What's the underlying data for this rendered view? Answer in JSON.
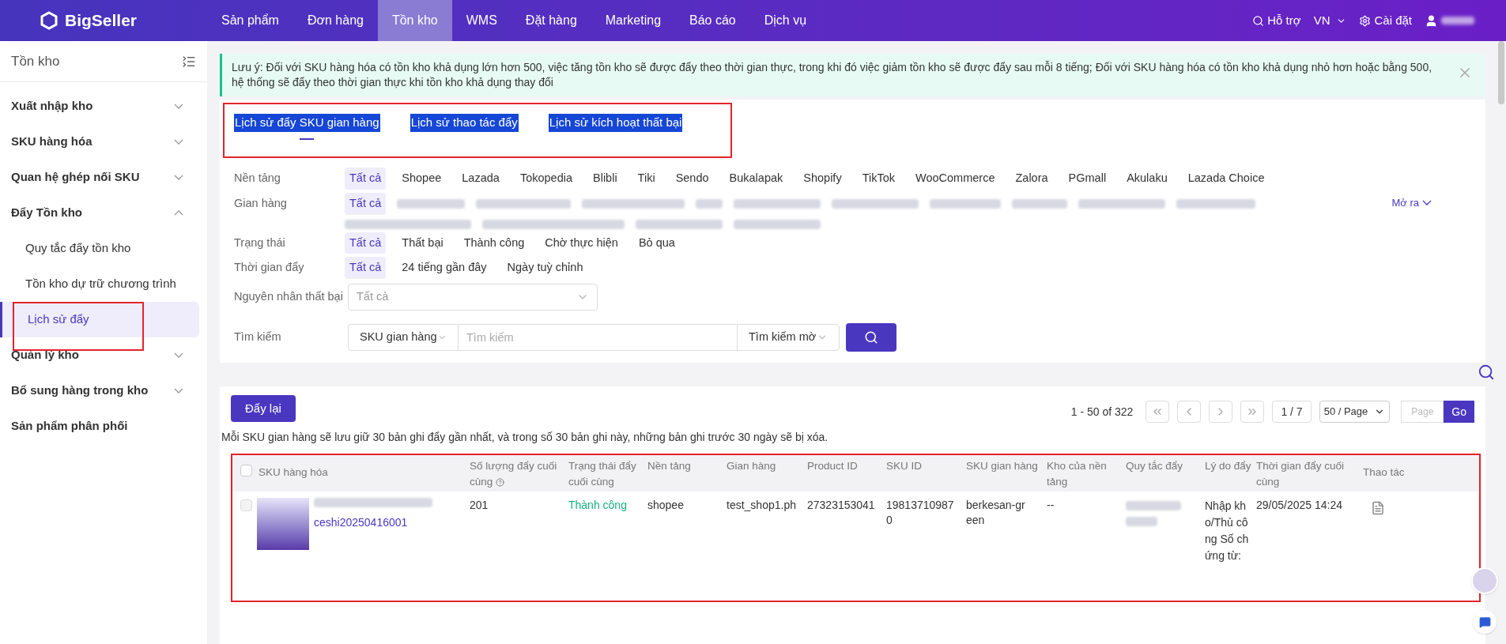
{
  "topbar": {
    "logo": "BigSeller",
    "nav": [
      {
        "label": "Sản phẩm",
        "selected": false
      },
      {
        "label": "Đơn hàng",
        "selected": false
      },
      {
        "label": "Tồn kho",
        "selected": true
      },
      {
        "label": "WMS",
        "selected": false
      },
      {
        "label": "Đặt hàng",
        "selected": false
      },
      {
        "label": "Marketing",
        "selected": false
      },
      {
        "label": "Báo cáo",
        "selected": false
      },
      {
        "label": "Dịch vụ",
        "selected": false
      }
    ],
    "help": "Hỗ trợ",
    "language": "VN",
    "settings": "Cài đặt"
  },
  "sidebar": {
    "title": "Tồn kho",
    "items": [
      {
        "label": "Xuất nhập kho",
        "expanded": false
      },
      {
        "label": "SKU hàng hóa",
        "expanded": false
      },
      {
        "label": "Quan hệ ghép nối SKU",
        "expanded": false
      },
      {
        "label": "Đẩy Tồn kho",
        "expanded": true,
        "children": [
          {
            "label": "Quy tắc đẩy tồn kho",
            "selected": false
          },
          {
            "label": "Tồn kho dự trữ chương trình",
            "selected": false
          },
          {
            "label": "Lịch sử đẩy",
            "selected": true
          }
        ]
      },
      {
        "label": "Quản lý kho",
        "expanded": false
      },
      {
        "label": "Bổ sung hàng trong kho",
        "expanded": false
      },
      {
        "label": "Sản phẩm phân phối"
      }
    ]
  },
  "notice": "Lưu ý: Đối với SKU hàng hóa có tồn kho khả dụng lớn hơn 500, việc tăng tồn kho sẽ được đẩy theo thời gian thực, trong khi đó việc giảm tồn kho sẽ được đẩy sau mỗi 8 tiếng; Đối với SKU hàng hóa có tồn kho khả dụng nhỏ hơn hoặc bằng 500, hệ thống sẽ đẩy theo thời gian thực khi tồn kho khả dụng thay đổi",
  "tabs": [
    {
      "label": "Lịch sử đẩy SKU gian hàng",
      "selected": true
    },
    {
      "label": "Lịch sử thao tác đẩy",
      "selected": false
    },
    {
      "label": "Lịch sử kích hoạt thất bại",
      "selected": false
    }
  ],
  "filters": [
    {
      "label": "Nền tảng",
      "options": [
        {
          "label": "Tất cả",
          "selected": true
        },
        {
          "label": "Shopee",
          "selected": false
        },
        {
          "label": "Lazada",
          "selected": false
        },
        {
          "label": "Tokopedia",
          "selected": false
        },
        {
          "label": "Blibli",
          "selected": false
        },
        {
          "label": "Tiki",
          "selected": false
        },
        {
          "label": "Sendo",
          "selected": false
        },
        {
          "label": "Bukalapak",
          "selected": false
        },
        {
          "label": "Shopify",
          "selected": false
        },
        {
          "label": "TikTok",
          "selected": false
        },
        {
          "label": "WooCommerce",
          "selected": false
        },
        {
          "label": "Zalora",
          "selected": false
        },
        {
          "label": "PGmall",
          "selected": false
        },
        {
          "label": "Akulaku",
          "selected": false
        },
        {
          "label": "Lazada Choice",
          "selected": false
        }
      ]
    },
    {
      "label": "Gian hàng",
      "options": [
        {
          "label": "Tất cả",
          "selected": true
        }
      ],
      "more": "Mở ra"
    },
    {
      "label": "Trạng thái",
      "options": [
        {
          "label": "Tất cả",
          "selected": true
        },
        {
          "label": "Thất bại",
          "selected": false
        },
        {
          "label": "Thành công",
          "selected": false
        },
        {
          "label": "Chờ thực hiện",
          "selected": false
        },
        {
          "label": "Bỏ qua",
          "selected": false
        }
      ]
    },
    {
      "label": "Thời gian đẩy",
      "options": [
        {
          "label": "Tất cả",
          "selected": true
        },
        {
          "label": "24 tiếng gần đây",
          "selected": false
        },
        {
          "label": "Ngày tuỳ chỉnh",
          "selected": false
        }
      ]
    }
  ],
  "failure_reason": {
    "label": "Nguyên nhân thất bại",
    "value": "Tất cả"
  },
  "search": {
    "label": "Tìm kiếm",
    "field": "SKU gian hàng",
    "placeholder": "Tìm kiếm",
    "mode": "Tìm kiếm mờ"
  },
  "repush_button": "Đẩy lại",
  "pagination": {
    "range": "1 - 50 of 322",
    "page": "1 / 7",
    "page_size": "50 / Page",
    "page_placeholder": "Page",
    "go": "Go"
  },
  "retention_note": "Mỗi SKU gian hàng sẽ lưu giữ 30 bản ghi đẩy gần nhất, và trong số 30 bản ghi này, những bản ghi trước 30 ngày sẽ bị xóa.",
  "table": {
    "select_all": false,
    "columns": [
      "SKU hàng hóa",
      "Số lượng đẩy cuối cùng",
      "Trạng thái đẩy cuối cùng",
      "Nền tảng",
      "Gian hàng",
      "Product ID",
      "SKU ID",
      "SKU gian hàng",
      "Kho của nền tảng",
      "Quy tắc đẩy",
      "Lý do đẩy",
      "Thời gian đẩy cuối cùng",
      "Thao tác"
    ],
    "rows": [
      {
        "checked": false,
        "sku": "ceshi20250416001",
        "quantity": "201",
        "status": "Thành công",
        "platform": "shopee",
        "shop": "test_shop1.ph",
        "product_id": "27323153041",
        "sku_id": "198137109870",
        "shop_sku": "berkesan-green",
        "warehouse": "--",
        "reason": "Nhập kho/Thủ công Số chứng từ:",
        "time": "29/05/2025 14:24"
      }
    ]
  }
}
